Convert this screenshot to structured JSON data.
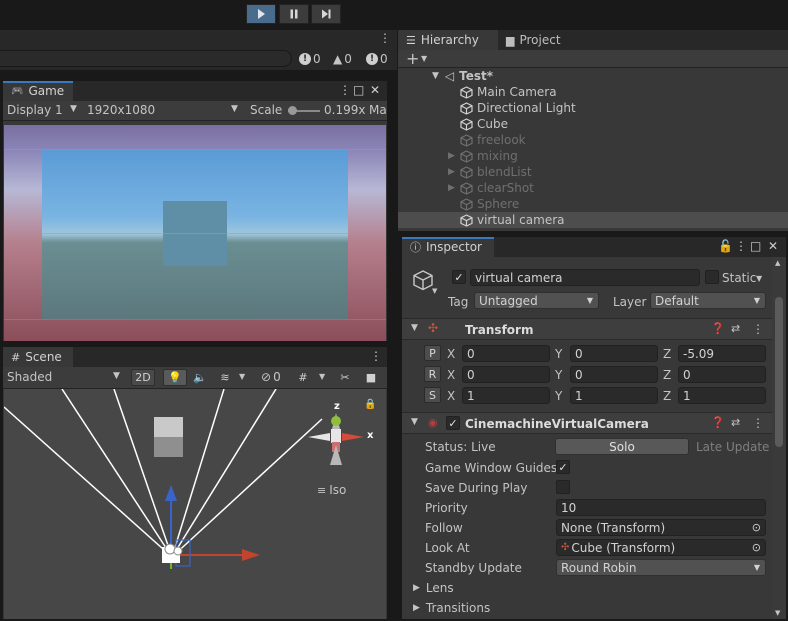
{
  "toolbar": {
    "play": "play",
    "pause": "pause",
    "step": "step"
  },
  "console": {
    "errors": "0",
    "warnings": "0",
    "logs": "0"
  },
  "game": {
    "tab": "Game",
    "display": "Display 1",
    "resolution": "1920x1080",
    "scale_label": "Scale",
    "scale_value": "0.199x",
    "maximize": "Ma"
  },
  "scene": {
    "tab": "Scene",
    "shading": "Shaded",
    "mode_2d": "2D",
    "hidden_count": "0",
    "gizmo_axis_x": "x",
    "gizmo_axis_z": "z",
    "projection": "Iso"
  },
  "hierarchy": {
    "tab": "Hierarchy",
    "project_tab": "Project",
    "scene_name": "Test*",
    "items": [
      {
        "label": "Main Camera",
        "dim": false,
        "fold": false
      },
      {
        "label": "Directional Light",
        "dim": false,
        "fold": false
      },
      {
        "label": "Cube",
        "dim": false,
        "fold": false
      },
      {
        "label": "freelook",
        "dim": true,
        "fold": false
      },
      {
        "label": "mixing",
        "dim": true,
        "fold": true
      },
      {
        "label": "blendList",
        "dim": true,
        "fold": true
      },
      {
        "label": "clearShot",
        "dim": true,
        "fold": true
      },
      {
        "label": "Sphere",
        "dim": true,
        "fold": false
      },
      {
        "label": "virtual camera",
        "dim": false,
        "fold": false,
        "selected": true
      }
    ]
  },
  "inspector": {
    "tab": "Inspector",
    "object_name": "virtual camera",
    "static_label": "Static",
    "tag_label": "Tag",
    "tag_value": "Untagged",
    "layer_label": "Layer",
    "layer_value": "Default",
    "transform": {
      "title": "Transform",
      "position": {
        "x": "0",
        "y": "0",
        "z": "-5.09"
      },
      "rotation": {
        "x": "0",
        "y": "0",
        "z": "0"
      },
      "scale": {
        "x": "1",
        "y": "1",
        "z": "1"
      }
    },
    "vcam": {
      "title": "CinemachineVirtualCamera",
      "status_label": "Status: Live",
      "solo_label": "Solo",
      "late_update": "Late Update",
      "game_window_guides": "Game Window Guides",
      "save_during_play": "Save During Play",
      "priority_label": "Priority",
      "priority_value": "10",
      "follow_label": "Follow",
      "follow_value": "None (Transform)",
      "look_at_label": "Look At",
      "look_at_value": "Cube (Transform)",
      "standby_label": "Standby Update",
      "standby_value": "Round Robin",
      "lens_label": "Lens",
      "transitions_label": "Transitions"
    }
  }
}
